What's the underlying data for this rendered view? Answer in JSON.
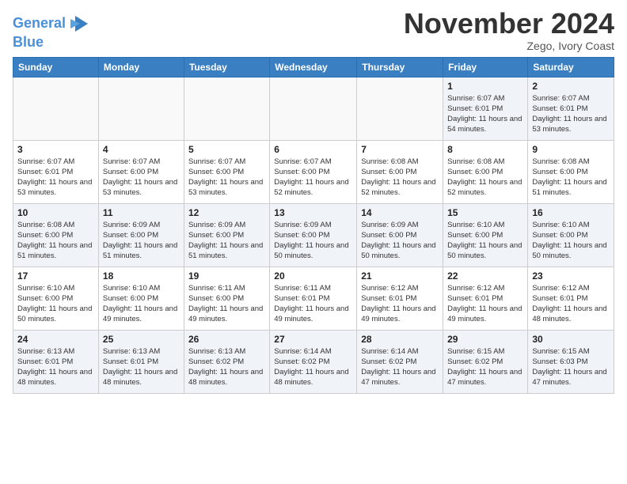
{
  "header": {
    "logo_line1": "General",
    "logo_line2": "Blue",
    "month": "November 2024",
    "location": "Zego, Ivory Coast"
  },
  "weekdays": [
    "Sunday",
    "Monday",
    "Tuesday",
    "Wednesday",
    "Thursday",
    "Friday",
    "Saturday"
  ],
  "weeks": [
    [
      {
        "day": "",
        "info": ""
      },
      {
        "day": "",
        "info": ""
      },
      {
        "day": "",
        "info": ""
      },
      {
        "day": "",
        "info": ""
      },
      {
        "day": "",
        "info": ""
      },
      {
        "day": "1",
        "info": "Sunrise: 6:07 AM\nSunset: 6:01 PM\nDaylight: 11 hours\nand 54 minutes."
      },
      {
        "day": "2",
        "info": "Sunrise: 6:07 AM\nSunset: 6:01 PM\nDaylight: 11 hours\nand 53 minutes."
      }
    ],
    [
      {
        "day": "3",
        "info": "Sunrise: 6:07 AM\nSunset: 6:01 PM\nDaylight: 11 hours\nand 53 minutes."
      },
      {
        "day": "4",
        "info": "Sunrise: 6:07 AM\nSunset: 6:00 PM\nDaylight: 11 hours\nand 53 minutes."
      },
      {
        "day": "5",
        "info": "Sunrise: 6:07 AM\nSunset: 6:00 PM\nDaylight: 11 hours\nand 53 minutes."
      },
      {
        "day": "6",
        "info": "Sunrise: 6:07 AM\nSunset: 6:00 PM\nDaylight: 11 hours\nand 52 minutes."
      },
      {
        "day": "7",
        "info": "Sunrise: 6:08 AM\nSunset: 6:00 PM\nDaylight: 11 hours\nand 52 minutes."
      },
      {
        "day": "8",
        "info": "Sunrise: 6:08 AM\nSunset: 6:00 PM\nDaylight: 11 hours\nand 52 minutes."
      },
      {
        "day": "9",
        "info": "Sunrise: 6:08 AM\nSunset: 6:00 PM\nDaylight: 11 hours\nand 51 minutes."
      }
    ],
    [
      {
        "day": "10",
        "info": "Sunrise: 6:08 AM\nSunset: 6:00 PM\nDaylight: 11 hours\nand 51 minutes."
      },
      {
        "day": "11",
        "info": "Sunrise: 6:09 AM\nSunset: 6:00 PM\nDaylight: 11 hours\nand 51 minutes."
      },
      {
        "day": "12",
        "info": "Sunrise: 6:09 AM\nSunset: 6:00 PM\nDaylight: 11 hours\nand 51 minutes."
      },
      {
        "day": "13",
        "info": "Sunrise: 6:09 AM\nSunset: 6:00 PM\nDaylight: 11 hours\nand 50 minutes."
      },
      {
        "day": "14",
        "info": "Sunrise: 6:09 AM\nSunset: 6:00 PM\nDaylight: 11 hours\nand 50 minutes."
      },
      {
        "day": "15",
        "info": "Sunrise: 6:10 AM\nSunset: 6:00 PM\nDaylight: 11 hours\nand 50 minutes."
      },
      {
        "day": "16",
        "info": "Sunrise: 6:10 AM\nSunset: 6:00 PM\nDaylight: 11 hours\nand 50 minutes."
      }
    ],
    [
      {
        "day": "17",
        "info": "Sunrise: 6:10 AM\nSunset: 6:00 PM\nDaylight: 11 hours\nand 50 minutes."
      },
      {
        "day": "18",
        "info": "Sunrise: 6:10 AM\nSunset: 6:00 PM\nDaylight: 11 hours\nand 49 minutes."
      },
      {
        "day": "19",
        "info": "Sunrise: 6:11 AM\nSunset: 6:00 PM\nDaylight: 11 hours\nand 49 minutes."
      },
      {
        "day": "20",
        "info": "Sunrise: 6:11 AM\nSunset: 6:01 PM\nDaylight: 11 hours\nand 49 minutes."
      },
      {
        "day": "21",
        "info": "Sunrise: 6:12 AM\nSunset: 6:01 PM\nDaylight: 11 hours\nand 49 minutes."
      },
      {
        "day": "22",
        "info": "Sunrise: 6:12 AM\nSunset: 6:01 PM\nDaylight: 11 hours\nand 49 minutes."
      },
      {
        "day": "23",
        "info": "Sunrise: 6:12 AM\nSunset: 6:01 PM\nDaylight: 11 hours\nand 48 minutes."
      }
    ],
    [
      {
        "day": "24",
        "info": "Sunrise: 6:13 AM\nSunset: 6:01 PM\nDaylight: 11 hours\nand 48 minutes."
      },
      {
        "day": "25",
        "info": "Sunrise: 6:13 AM\nSunset: 6:01 PM\nDaylight: 11 hours\nand 48 minutes."
      },
      {
        "day": "26",
        "info": "Sunrise: 6:13 AM\nSunset: 6:02 PM\nDaylight: 11 hours\nand 48 minutes."
      },
      {
        "day": "27",
        "info": "Sunrise: 6:14 AM\nSunset: 6:02 PM\nDaylight: 11 hours\nand 48 minutes."
      },
      {
        "day": "28",
        "info": "Sunrise: 6:14 AM\nSunset: 6:02 PM\nDaylight: 11 hours\nand 47 minutes."
      },
      {
        "day": "29",
        "info": "Sunrise: 6:15 AM\nSunset: 6:02 PM\nDaylight: 11 hours\nand 47 minutes."
      },
      {
        "day": "30",
        "info": "Sunrise: 6:15 AM\nSunset: 6:03 PM\nDaylight: 11 hours\nand 47 minutes."
      }
    ]
  ]
}
